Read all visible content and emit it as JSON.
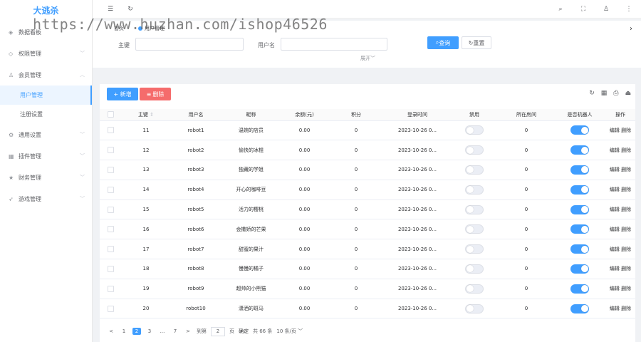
{
  "sidebar": {
    "logo": "大逃杀",
    "items": [
      {
        "label": "数据看板",
        "icon": "dashboard-icon",
        "chevron": ""
      },
      {
        "label": "权限管理",
        "icon": "shield-icon",
        "chevron": "﹀"
      },
      {
        "label": "会员管理",
        "icon": "user-icon",
        "chevron": "︿"
      },
      {
        "label": "通用设置",
        "icon": "gear-icon",
        "chevron": "﹀"
      },
      {
        "label": "插件管理",
        "icon": "plugin-icon",
        "chevron": "﹀"
      },
      {
        "label": "财务管理",
        "icon": "finance-icon",
        "chevron": "﹀"
      },
      {
        "label": "游戏管理",
        "icon": "game-icon",
        "chevron": "﹀"
      }
    ],
    "subitems": [
      {
        "label": "用户管理"
      },
      {
        "label": "注册设置"
      }
    ]
  },
  "topbar": {
    "menu_icon": "☰",
    "refresh_icon": "↻"
  },
  "tabs": [
    {
      "label": "首页"
    },
    {
      "label": "用户管理"
    }
  ],
  "search": {
    "field1_label": "主键",
    "field2_label": "用户名",
    "query_label": "查询",
    "reset_label": "重置",
    "expand_label": "展开"
  },
  "toolbar": {
    "add_label": "+ 新增",
    "delete_label": "删除"
  },
  "table": {
    "headers": [
      "主键",
      "用户名",
      "昵称",
      "余额(元)",
      "积分",
      "登录时间",
      "禁用",
      "所在房间",
      "是否机器人",
      "操作"
    ],
    "rows": [
      {
        "id": "11",
        "username": "robot1",
        "nickname": "温婉的店员",
        "balance": "0.00",
        "points": "0",
        "login": "2023-10-26 0...",
        "room": "0"
      },
      {
        "id": "12",
        "username": "robot2",
        "nickname": "愉快的冰棍",
        "balance": "0.00",
        "points": "0",
        "login": "2023-10-26 0...",
        "room": "0"
      },
      {
        "id": "13",
        "username": "robot3",
        "nickname": "独藏的学姐",
        "balance": "0.00",
        "points": "0",
        "login": "2023-10-26 0...",
        "room": "0"
      },
      {
        "id": "14",
        "username": "robot4",
        "nickname": "开心的咖啡豆",
        "balance": "0.00",
        "points": "0",
        "login": "2023-10-26 0...",
        "room": "0"
      },
      {
        "id": "15",
        "username": "robot5",
        "nickname": "活力的樱桃",
        "balance": "0.00",
        "points": "0",
        "login": "2023-10-26 0...",
        "room": "0"
      },
      {
        "id": "16",
        "username": "robot6",
        "nickname": "会撒娇的芒果",
        "balance": "0.00",
        "points": "0",
        "login": "2023-10-26 0...",
        "room": "0"
      },
      {
        "id": "17",
        "username": "robot7",
        "nickname": "甜蜜的果汁",
        "balance": "0.00",
        "points": "0",
        "login": "2023-10-26 0...",
        "room": "0"
      },
      {
        "id": "18",
        "username": "robot8",
        "nickname": "慢慢的橘子",
        "balance": "0.00",
        "points": "0",
        "login": "2023-10-26 0...",
        "room": "0"
      },
      {
        "id": "19",
        "username": "robot9",
        "nickname": "超帅的小熊猫",
        "balance": "0.00",
        "points": "0",
        "login": "2023-10-26 0...",
        "room": "0"
      },
      {
        "id": "20",
        "username": "robot10",
        "nickname": "潇洒的斑马",
        "balance": "0.00",
        "points": "0",
        "login": "2023-10-26 0...",
        "room": "0"
      }
    ],
    "edit_label": "编辑",
    "delete_label": "删除"
  },
  "pagination": {
    "prev": "<",
    "pages": [
      "1",
      "2",
      "3",
      "...",
      "7"
    ],
    "next": ">",
    "goto_label": "到第",
    "goto_value": "2",
    "page_unit": "页",
    "confirm": "确定",
    "total": "共 66 条",
    "page_size": "10 条/页"
  },
  "watermark": "https://www.huzhan.com/ishop46526",
  "colors": {
    "primary": "#409eff",
    "danger": "#f56c6c"
  }
}
